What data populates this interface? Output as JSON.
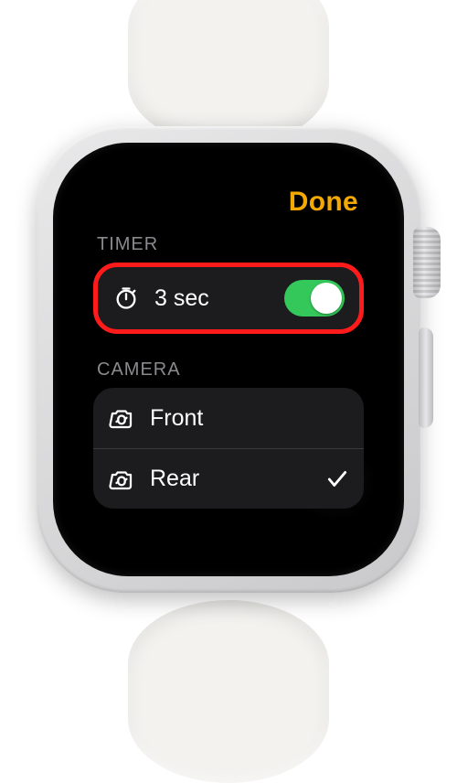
{
  "header": {
    "done_label": "Done"
  },
  "accent_color": "#f2a900",
  "timer": {
    "section_label": "TIMER",
    "value_label": "3 sec",
    "enabled": true
  },
  "camera": {
    "section_label": "CAMERA",
    "options": [
      {
        "label": "Front",
        "selected": false
      },
      {
        "label": "Rear",
        "selected": true
      }
    ]
  }
}
